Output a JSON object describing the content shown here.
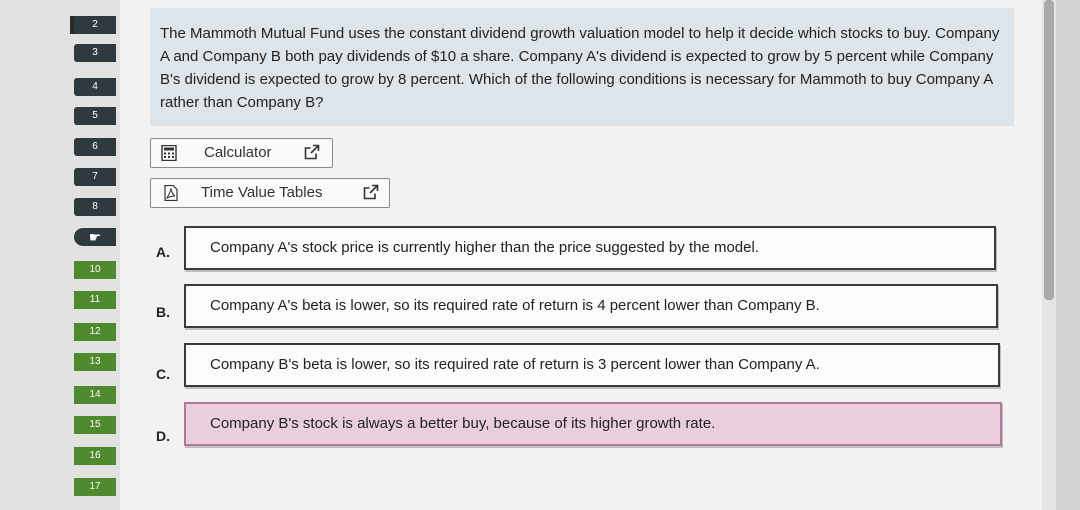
{
  "navigator": {
    "items": [
      {
        "label": "2",
        "state": "done"
      },
      {
        "label": "3",
        "state": "done"
      },
      {
        "label": "4",
        "state": "done"
      },
      {
        "label": "5",
        "state": "done"
      },
      {
        "label": "6",
        "state": "done"
      },
      {
        "label": "7",
        "state": "done"
      },
      {
        "label": "8",
        "state": "done"
      },
      {
        "label": "",
        "state": "current"
      },
      {
        "label": "10",
        "state": "todo"
      },
      {
        "label": "11",
        "state": "todo"
      },
      {
        "label": "12",
        "state": "todo"
      },
      {
        "label": "13",
        "state": "todo"
      },
      {
        "label": "14",
        "state": "todo"
      },
      {
        "label": "15",
        "state": "todo"
      },
      {
        "label": "16",
        "state": "todo"
      },
      {
        "label": "17",
        "state": "todo"
      }
    ]
  },
  "question": {
    "text": "The Mammoth Mutual Fund uses the constant dividend growth valuation model to help it decide which stocks to buy. Company A and Company B both pay dividends of $10 a share. Company A's dividend is expected to grow by 5 percent while Company B's dividend is expected to grow by 8 percent. Which of the following conditions is necessary for Mammoth to buy Company A rather than Company B?"
  },
  "tools": {
    "calculator": "Calculator",
    "time_value_tables": "Time Value Tables"
  },
  "options": [
    {
      "letter": "A.",
      "text": "Company A's stock price is currently higher than the price suggested by the model.",
      "selected": false
    },
    {
      "letter": "B.",
      "text": "Company A's beta is lower, so its required rate of return is 4 percent lower than Company B.",
      "selected": false
    },
    {
      "letter": "C.",
      "text": "Company B's beta is lower, so its required rate of return is 3 percent lower than Company A.",
      "selected": false
    },
    {
      "letter": "D.",
      "text": "Company B's stock is always a better buy, because of its higher growth rate.",
      "selected": true
    }
  ],
  "colors": {
    "done": "#2f3a3f",
    "todo": "#4f8a2e",
    "selected_option": "#e9cfdc"
  }
}
